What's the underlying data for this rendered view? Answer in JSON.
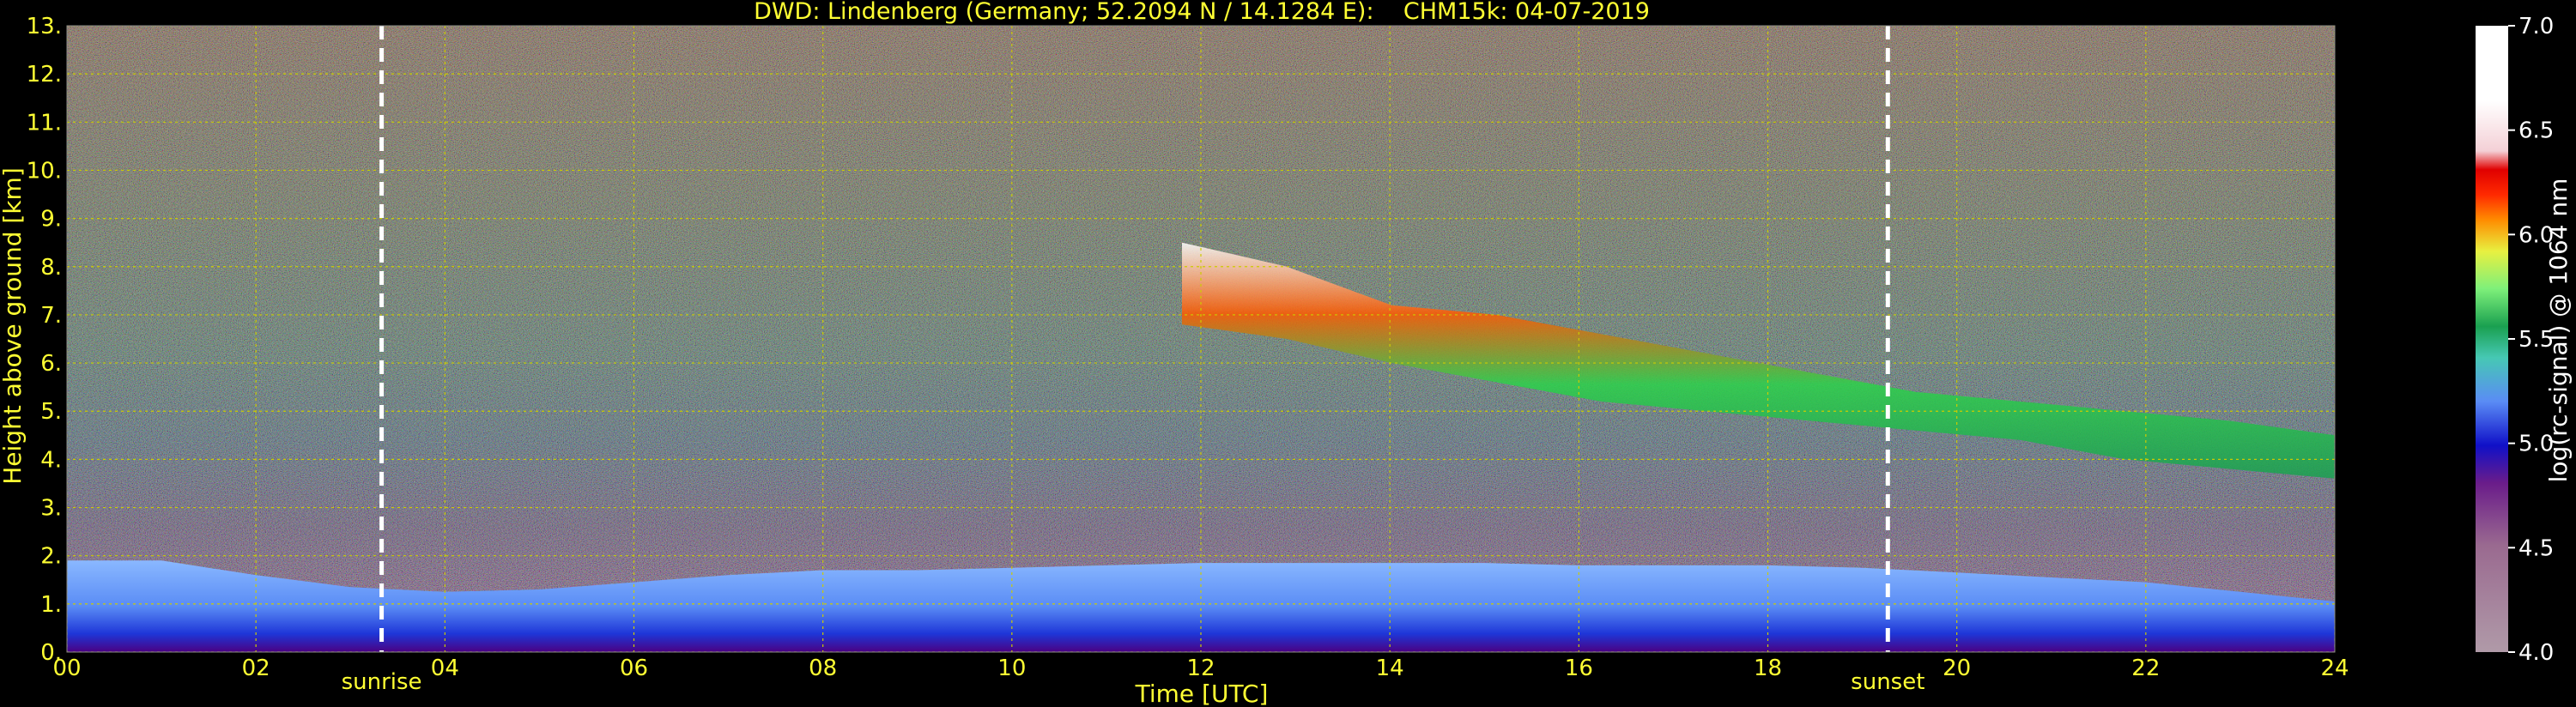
{
  "chart_data": {
    "type": "heatmap",
    "title": "DWD: Lindenberg (Germany; 52.2094 N / 14.1284 E):    CHM15k: 04-07-2019",
    "xlabel": "Time [UTC]",
    "ylabel": "Height above ground [km]",
    "xlim": [
      0,
      24
    ],
    "ylim": [
      0,
      13
    ],
    "x_ticks": [
      0,
      2,
      4,
      6,
      8,
      10,
      12,
      14,
      16,
      18,
      20,
      22,
      24
    ],
    "x_tick_labels": [
      "00",
      "02",
      "04",
      "06",
      "08",
      "10",
      "12",
      "14",
      "16",
      "18",
      "20",
      "22",
      "24"
    ],
    "y_ticks": [
      0,
      1,
      2,
      3,
      4,
      5,
      6,
      7,
      8,
      9,
      10,
      11,
      12,
      13
    ],
    "y_tick_labels": [
      "0.",
      "1.",
      "2.",
      "3.",
      "4.",
      "5.",
      "6.",
      "7.",
      "8.",
      "9.",
      "10.",
      "11.",
      "12.",
      "13."
    ],
    "grid": true,
    "markers": [
      {
        "label": "sunrise",
        "time": 3.33
      },
      {
        "label": "sunset",
        "time": 19.27
      }
    ],
    "colorbar": {
      "label": "log(rc-signal) @ 1064 nm",
      "range": [
        4.0,
        7.0
      ],
      "ticks": [
        4.0,
        4.5,
        5.0,
        5.5,
        6.0,
        6.5,
        7.0
      ],
      "tick_labels": [
        "4.0",
        "4.5",
        "5.0",
        "5.5",
        "6.0",
        "6.5",
        "7.0"
      ],
      "colors": [
        "#b09aa8",
        "#a07898",
        "#8a4e8e",
        "#6a1c8a",
        "#4b0082",
        "#1010c8",
        "#2a52e8",
        "#5a8cf5",
        "#90b8ff",
        "#46c8b4",
        "#1aa050",
        "#2cd24a",
        "#7ef07a",
        "#ccf040",
        "#ffd400",
        "#ff8c00",
        "#ff4500",
        "#e00000",
        "#f0c8d0",
        "#ffffff"
      ]
    },
    "features": [
      {
        "name": "boundary layer",
        "from": 0,
        "to": 24,
        "top_km": [
          1.9,
          1.9,
          1.6,
          1.35,
          1.25,
          1.3,
          1.45,
          1.6,
          1.7,
          1.7,
          1.75,
          1.8,
          1.85,
          1.85,
          1.85,
          1.85,
          1.8,
          1.8,
          1.8,
          1.75,
          1.65,
          1.55,
          1.45,
          1.25,
          1.05
        ]
      },
      {
        "name": "cirrus",
        "from": 11.8,
        "to": 24,
        "top_km": [
          8.5,
          8.0,
          7.2,
          7.0,
          6.6,
          6.2,
          5.8,
          5.4,
          5.2,
          5.0,
          4.8,
          4.5
        ],
        "base_km": [
          6.8,
          6.5,
          6.0,
          5.6,
          5.2,
          5.0,
          4.8,
          4.6,
          4.4,
          4.0,
          3.8,
          3.6
        ]
      }
    ],
    "colors": {
      "text": "#ffff33",
      "background": "#000000",
      "marker": "#ffffff"
    }
  }
}
